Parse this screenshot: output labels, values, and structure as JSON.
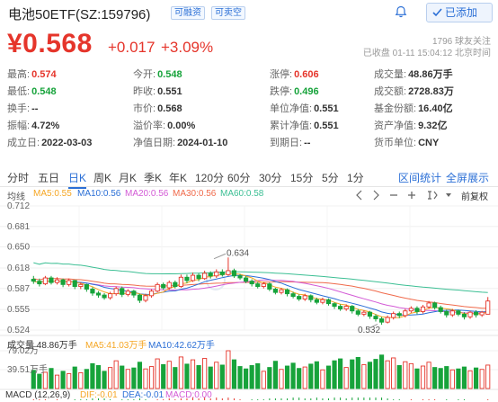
{
  "header": {
    "title": "电池50ETF(SZ:159796)",
    "tags": [
      "可融资",
      "可卖空"
    ],
    "added_label": "已添加"
  },
  "quote": {
    "price": "¥0.568",
    "change": "+0.017",
    "change_pct": "+3.09%",
    "followers": "1796 球友关注",
    "status": "已收盘 01-11 15:04:12 北京时间"
  },
  "stats": [
    [
      {
        "k": "最高:",
        "v": "0.574",
        "c": "red"
      },
      {
        "k": "今开:",
        "v": "0.548",
        "c": "green"
      },
      {
        "k": "涨停:",
        "v": "0.606",
        "c": "red"
      },
      {
        "k": "成交量:",
        "v": "48.86万手",
        "c": ""
      }
    ],
    [
      {
        "k": "最低:",
        "v": "0.548",
        "c": "green"
      },
      {
        "k": "昨收:",
        "v": "0.551",
        "c": ""
      },
      {
        "k": "跌停:",
        "v": "0.496",
        "c": "green"
      },
      {
        "k": "成交额:",
        "v": "2728.83万",
        "c": ""
      }
    ],
    [
      {
        "k": "换手:",
        "v": "--",
        "c": ""
      },
      {
        "k": "市价:",
        "v": "0.568",
        "c": ""
      },
      {
        "k": "单位净值:",
        "v": "0.551",
        "c": ""
      },
      {
        "k": "基金份额:",
        "v": "16.40亿",
        "c": ""
      }
    ],
    [
      {
        "k": "振幅:",
        "v": "4.72%",
        "c": ""
      },
      {
        "k": "溢价率:",
        "v": "0.00%",
        "c": ""
      },
      {
        "k": "累计净值:",
        "v": "0.551",
        "c": ""
      },
      {
        "k": "资产净值:",
        "v": "9.32亿",
        "c": ""
      }
    ],
    [
      {
        "k": "成立日:",
        "v": "2022-03-03",
        "c": ""
      },
      {
        "k": "净值日期:",
        "v": "2024-01-10",
        "c": ""
      },
      {
        "k": "到期日:",
        "v": "--",
        "c": ""
      },
      {
        "k": "货币单位:",
        "v": "CNY",
        "c": ""
      }
    ]
  ],
  "tabs": {
    "periods": [
      "分时",
      "五日",
      "日K",
      "周K",
      "月K",
      "季K",
      "年K",
      "120分",
      "60分",
      "30分",
      "15分",
      "5分",
      "1分"
    ],
    "active": "日K",
    "range_stats": "区间统计",
    "fullscreen": "全屏展示"
  },
  "ma": {
    "label": "均线",
    "ma5": "MA5:0.55",
    "ma10": "MA10:0.56",
    "ma20": "MA20:0.56",
    "ma30": "MA30:0.56",
    "ma60": "MA60:0.58",
    "adjust": "前复权",
    "colors": {
      "ma5": "#f5a623",
      "ma10": "#2b6fd6",
      "ma20": "#d35bd6",
      "ma30": "#f06a4b",
      "ma60": "#3cbf94"
    }
  },
  "price_axis": [
    "0.712",
    "0.681",
    "0.650",
    "0.618",
    "0.587",
    "0.555",
    "0.524"
  ],
  "annotations": {
    "high": "0.634",
    "low": "0.532"
  },
  "volume": {
    "label": "成交量 48.86万手",
    "ma5": "MA5:41.03万手",
    "ma10": "MA10:42.62万手",
    "axis_top": "79.02万",
    "axis_mid": "39.51万手"
  },
  "macd": {
    "label": "MACD (12,26,9)",
    "dif": "DIF:-0.01",
    "dea": "DEA:-0.01",
    "macd": "MACD:0.00"
  },
  "candles": [
    [
      0.601,
      0.598,
      0.606,
      0.594
    ],
    [
      0.598,
      0.594,
      0.602,
      0.59
    ],
    [
      0.594,
      0.603,
      0.606,
      0.592
    ],
    [
      0.603,
      0.596,
      0.606,
      0.593
    ],
    [
      0.596,
      0.6,
      0.604,
      0.593
    ],
    [
      0.6,
      0.593,
      0.602,
      0.589
    ],
    [
      0.593,
      0.599,
      0.602,
      0.59
    ],
    [
      0.599,
      0.59,
      0.6,
      0.586
    ],
    [
      0.59,
      0.593,
      0.596,
      0.586
    ],
    [
      0.593,
      0.586,
      0.594,
      0.582
    ],
    [
      0.586,
      0.58,
      0.589,
      0.576
    ],
    [
      0.58,
      0.577,
      0.583,
      0.573
    ],
    [
      0.577,
      0.573,
      0.58,
      0.57
    ],
    [
      0.573,
      0.579,
      0.582,
      0.57
    ],
    [
      0.579,
      0.587,
      0.59,
      0.576
    ],
    [
      0.587,
      0.578,
      0.59,
      0.574
    ],
    [
      0.578,
      0.583,
      0.586,
      0.575
    ],
    [
      0.583,
      0.577,
      0.585,
      0.573
    ],
    [
      0.577,
      0.569,
      0.579,
      0.565
    ],
    [
      0.569,
      0.576,
      0.579,
      0.566
    ],
    [
      0.576,
      0.583,
      0.586,
      0.573
    ],
    [
      0.583,
      0.593,
      0.596,
      0.581
    ],
    [
      0.593,
      0.588,
      0.596,
      0.585
    ],
    [
      0.588,
      0.596,
      0.599,
      0.585
    ],
    [
      0.596,
      0.59,
      0.599,
      0.587
    ],
    [
      0.59,
      0.604,
      0.608,
      0.588
    ],
    [
      0.604,
      0.599,
      0.608,
      0.595
    ],
    [
      0.599,
      0.607,
      0.611,
      0.597
    ],
    [
      0.607,
      0.602,
      0.61,
      0.598
    ],
    [
      0.602,
      0.61,
      0.614,
      0.6
    ],
    [
      0.61,
      0.606,
      0.613,
      0.602
    ],
    [
      0.606,
      0.612,
      0.616,
      0.603
    ],
    [
      0.612,
      0.608,
      0.616,
      0.605
    ],
    [
      0.608,
      0.614,
      0.634,
      0.606
    ],
    [
      0.614,
      0.606,
      0.617,
      0.603
    ],
    [
      0.606,
      0.603,
      0.609,
      0.6
    ],
    [
      0.603,
      0.598,
      0.606,
      0.595
    ],
    [
      0.598,
      0.594,
      0.601,
      0.59
    ],
    [
      0.594,
      0.59,
      0.597,
      0.587
    ],
    [
      0.59,
      0.594,
      0.597,
      0.587
    ],
    [
      0.594,
      0.586,
      0.596,
      0.583
    ],
    [
      0.586,
      0.581,
      0.588,
      0.578
    ],
    [
      0.581,
      0.585,
      0.588,
      0.578
    ],
    [
      0.585,
      0.579,
      0.587,
      0.575
    ],
    [
      0.579,
      0.575,
      0.582,
      0.572
    ],
    [
      0.575,
      0.571,
      0.578,
      0.568
    ],
    [
      0.571,
      0.576,
      0.579,
      0.568
    ],
    [
      0.576,
      0.57,
      0.578,
      0.566
    ],
    [
      0.57,
      0.566,
      0.573,
      0.563
    ],
    [
      0.566,
      0.57,
      0.573,
      0.563
    ],
    [
      0.57,
      0.564,
      0.572,
      0.561
    ],
    [
      0.564,
      0.56,
      0.566,
      0.556
    ],
    [
      0.56,
      0.556,
      0.563,
      0.553
    ],
    [
      0.556,
      0.56,
      0.563,
      0.553
    ],
    [
      0.56,
      0.553,
      0.562,
      0.549
    ],
    [
      0.553,
      0.548,
      0.556,
      0.545
    ],
    [
      0.548,
      0.551,
      0.554,
      0.545
    ],
    [
      0.551,
      0.545,
      0.553,
      0.541
    ],
    [
      0.545,
      0.541,
      0.548,
      0.537
    ],
    [
      0.541,
      0.536,
      0.544,
      0.532
    ],
    [
      0.536,
      0.543,
      0.546,
      0.534
    ],
    [
      0.543,
      0.549,
      0.552,
      0.54
    ],
    [
      0.549,
      0.546,
      0.552,
      0.542
    ],
    [
      0.546,
      0.553,
      0.556,
      0.543
    ],
    [
      0.553,
      0.557,
      0.56,
      0.55
    ],
    [
      0.557,
      0.552,
      0.56,
      0.548
    ],
    [
      0.552,
      0.559,
      0.562,
      0.549
    ],
    [
      0.559,
      0.565,
      0.568,
      0.556
    ],
    [
      0.565,
      0.558,
      0.567,
      0.555
    ],
    [
      0.558,
      0.552,
      0.561,
      0.549
    ],
    [
      0.552,
      0.547,
      0.555,
      0.543
    ],
    [
      0.547,
      0.553,
      0.556,
      0.544
    ],
    [
      0.553,
      0.548,
      0.555,
      0.545
    ],
    [
      0.548,
      0.544,
      0.551,
      0.54
    ],
    [
      0.544,
      0.551,
      0.553,
      0.541
    ],
    [
      0.551,
      0.547,
      0.554,
      0.543
    ],
    [
      0.547,
      0.551,
      0.553,
      0.544
    ],
    [
      0.548,
      0.568,
      0.574,
      0.548
    ]
  ],
  "volumes": [
    38,
    30,
    34,
    42,
    28,
    36,
    31,
    45,
    33,
    40,
    52,
    48,
    36,
    44,
    58,
    47,
    40,
    43,
    55,
    41,
    46,
    62,
    50,
    57,
    44,
    66,
    51,
    60,
    48,
    63,
    45,
    55,
    49,
    79,
    60,
    46,
    41,
    48,
    52,
    36,
    44,
    57,
    40,
    47,
    53,
    42,
    45,
    51,
    56,
    39,
    47,
    58,
    62,
    44,
    60,
    65,
    50,
    55,
    61,
    70,
    58,
    64,
    48,
    56,
    52,
    41,
    47,
    55,
    44,
    42,
    46,
    39,
    41,
    45,
    37,
    43,
    40,
    49
  ],
  "macd_bars": [
    1,
    1,
    1,
    0,
    1,
    0,
    0,
    -1,
    -1,
    -1,
    -2,
    -2,
    -2,
    -1,
    0,
    -1,
    -1,
    -1,
    -2,
    -1,
    0,
    1,
    1,
    2,
    1,
    2,
    2,
    3,
    2,
    3,
    2,
    3,
    2,
    3,
    2,
    1,
    0,
    -1,
    -1,
    -1,
    -2,
    -2,
    -2,
    -2,
    -3,
    -3,
    -2,
    -2,
    -3,
    -2,
    -2,
    -3,
    -3,
    -2,
    -3,
    -3,
    -3,
    -3,
    -3,
    -3,
    -2,
    -1,
    -1,
    0,
    1,
    0,
    1,
    1,
    1,
    0,
    -1,
    0,
    -1,
    -1,
    0,
    0,
    0,
    1
  ]
}
